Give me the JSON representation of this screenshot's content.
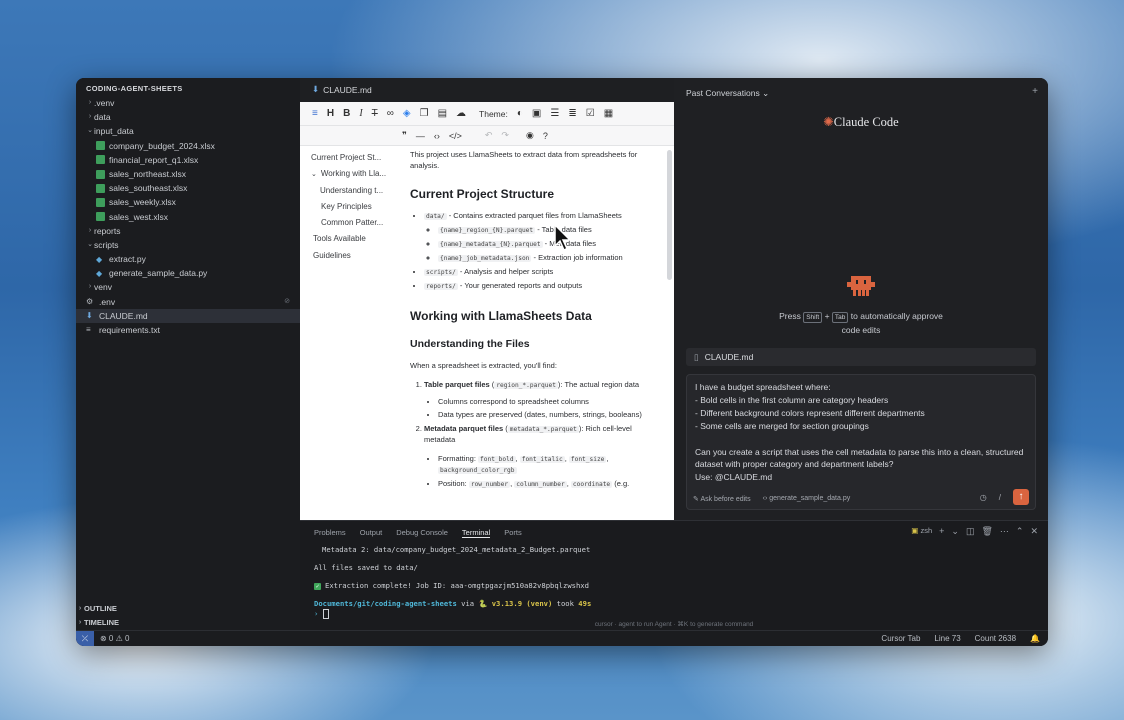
{
  "sidebar": {
    "title": "CODING-AGENT-SHEETS",
    "items": [
      {
        "label": ".venv",
        "type": "folder",
        "depth": 0
      },
      {
        "label": "data",
        "type": "folder",
        "depth": 0
      },
      {
        "label": "input_data",
        "type": "folder-open",
        "depth": 0
      },
      {
        "label": "company_budget_2024.xlsx",
        "type": "xlsx",
        "depth": 1
      },
      {
        "label": "financial_report_q1.xlsx",
        "type": "xlsx",
        "depth": 1
      },
      {
        "label": "sales_northeast.xlsx",
        "type": "xlsx",
        "depth": 1
      },
      {
        "label": "sales_southeast.xlsx",
        "type": "xlsx",
        "depth": 1
      },
      {
        "label": "sales_weekly.xlsx",
        "type": "xlsx",
        "depth": 1
      },
      {
        "label": "sales_west.xlsx",
        "type": "xlsx",
        "depth": 1
      },
      {
        "label": "reports",
        "type": "folder",
        "depth": 0
      },
      {
        "label": "scripts",
        "type": "folder-open",
        "depth": 0
      },
      {
        "label": "extract.py",
        "type": "py",
        "depth": 1
      },
      {
        "label": "generate_sample_data.py",
        "type": "py",
        "depth": 1
      },
      {
        "label": "venv",
        "type": "folder",
        "depth": 0
      },
      {
        "label": ".env",
        "type": "env",
        "depth": 0
      },
      {
        "label": "CLAUDE.md",
        "type": "md",
        "depth": 0,
        "selected": true
      },
      {
        "label": "requirements.txt",
        "type": "txt",
        "depth": 0
      }
    ],
    "outline_label": "OUTLINE",
    "timeline_label": "TIMELINE"
  },
  "editor": {
    "tab_label": "CLAUDE.md",
    "theme_label": "Theme:",
    "toc": [
      "Current Project St...",
      "Working with Lla...",
      "Understanding t...",
      "Key Principles",
      "Common Patter...",
      "Tools Available",
      "Guidelines"
    ],
    "intro": "This project uses LlamaSheets to extract data from spreadsheets for analysis.",
    "h_structure": "Current Project Structure",
    "structure": {
      "data_code": "data/",
      "data_text": " - Contains extracted parquet files from LlamaSheets",
      "sub1_code": "{name}_region_{N}.parquet",
      "sub1_text": " - Table data files",
      "sub2_code": "{name}_metadata_{N}.parquet",
      "sub2_text": " - Metadata files",
      "sub3_code": "{name}_job_metadata.json",
      "sub3_text": " - Extraction job information",
      "scripts_code": "scripts/",
      "scripts_text": " - Analysis and helper scripts",
      "reports_code": "reports/",
      "reports_text": " - Your generated reports and outputs"
    },
    "h_working": "Working with LlamaSheets Data",
    "h_understanding": "Understanding the Files",
    "when_text": "When a spreadsheet is extracted, you'll find:",
    "table_bold": "Table parquet files",
    "table_code": "region_*.parquet",
    "table_text": ": The actual region data",
    "table_sub1": "Columns correspond to spreadsheet columns",
    "table_sub2": "Data types are preserved (dates, numbers, strings, booleans)",
    "meta_bold": "Metadata parquet files",
    "meta_code": "metadata_*.parquet",
    "meta_text": ": Rich cell-level metadata",
    "fmt_label": "Formatting: ",
    "fmt_codes": [
      "font_bold",
      "font_italic",
      "font_size",
      "background_color_rgb"
    ],
    "pos_label": "Position: ",
    "pos_codes": [
      "row_number",
      "column_number",
      "coordinate"
    ],
    "pos_tail": " (e.g."
  },
  "panel": {
    "past_conversations": "Past Conversations",
    "brand_mark": "✺",
    "brand_name": "Claude Code",
    "hint_press": "Press",
    "hint_shift": "Shift",
    "hint_tab": "Tab",
    "hint_rest": "to automatically approve",
    "hint_line2": "code edits",
    "attachment": "CLAUDE.md",
    "prompt": "I have a budget spreadsheet where:\n- Bold cells in the first column are category headers\n- Different background colors represent different departments\n- Some cells are merged for section groupings\n\nCan you create a script that uses the cell metadata to parse this into a clean, structured dataset with proper category and department labels?\nUse: @CLAUDE.md",
    "ask_before_edits": "Ask before edits",
    "context_file": "generate_sample_data.py",
    "accent": "#d9643f"
  },
  "terminal": {
    "tabs": [
      "Problems",
      "Output",
      "Debug Console",
      "Terminal",
      "Ports"
    ],
    "active_tab": "Terminal",
    "shell": "zsh",
    "line1": "Metadata 2: data/company_budget_2024_metadata_2_Budget.parquet",
    "line2": "All files saved to data/",
    "line3": "Extraction complete! Job ID: aaa-omgtpgazjm510a82v8pbqlzwshxd",
    "prompt_path": "Documents/git/coding-agent-sheets",
    "prompt_via": " via ",
    "prompt_ver": "v3.13.9 (venv)",
    "prompt_took": " took ",
    "prompt_dur": "49s",
    "footer": "cursor · agent to run Agent · ⌘K to generate command"
  },
  "status": {
    "problems": "⊗ 0 ⚠ 0",
    "cursor_tab": "Cursor Tab",
    "line": "Line 73",
    "count": "Count 2638"
  }
}
